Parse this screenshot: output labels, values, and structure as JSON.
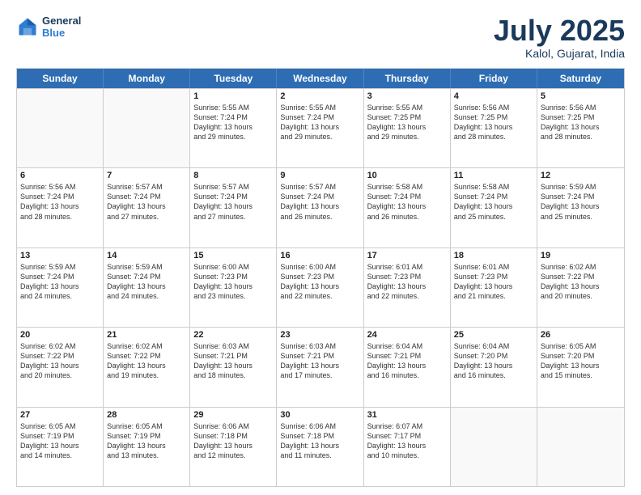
{
  "header": {
    "logo_line1": "General",
    "logo_line2": "Blue",
    "month": "July 2025",
    "location": "Kalol, Gujarat, India"
  },
  "weekdays": [
    "Sunday",
    "Monday",
    "Tuesday",
    "Wednesday",
    "Thursday",
    "Friday",
    "Saturday"
  ],
  "rows": [
    [
      {
        "day": "",
        "lines": []
      },
      {
        "day": "",
        "lines": []
      },
      {
        "day": "1",
        "lines": [
          "Sunrise: 5:55 AM",
          "Sunset: 7:24 PM",
          "Daylight: 13 hours",
          "and 29 minutes."
        ]
      },
      {
        "day": "2",
        "lines": [
          "Sunrise: 5:55 AM",
          "Sunset: 7:24 PM",
          "Daylight: 13 hours",
          "and 29 minutes."
        ]
      },
      {
        "day": "3",
        "lines": [
          "Sunrise: 5:55 AM",
          "Sunset: 7:25 PM",
          "Daylight: 13 hours",
          "and 29 minutes."
        ]
      },
      {
        "day": "4",
        "lines": [
          "Sunrise: 5:56 AM",
          "Sunset: 7:25 PM",
          "Daylight: 13 hours",
          "and 28 minutes."
        ]
      },
      {
        "day": "5",
        "lines": [
          "Sunrise: 5:56 AM",
          "Sunset: 7:25 PM",
          "Daylight: 13 hours",
          "and 28 minutes."
        ]
      }
    ],
    [
      {
        "day": "6",
        "lines": [
          "Sunrise: 5:56 AM",
          "Sunset: 7:24 PM",
          "Daylight: 13 hours",
          "and 28 minutes."
        ]
      },
      {
        "day": "7",
        "lines": [
          "Sunrise: 5:57 AM",
          "Sunset: 7:24 PM",
          "Daylight: 13 hours",
          "and 27 minutes."
        ]
      },
      {
        "day": "8",
        "lines": [
          "Sunrise: 5:57 AM",
          "Sunset: 7:24 PM",
          "Daylight: 13 hours",
          "and 27 minutes."
        ]
      },
      {
        "day": "9",
        "lines": [
          "Sunrise: 5:57 AM",
          "Sunset: 7:24 PM",
          "Daylight: 13 hours",
          "and 26 minutes."
        ]
      },
      {
        "day": "10",
        "lines": [
          "Sunrise: 5:58 AM",
          "Sunset: 7:24 PM",
          "Daylight: 13 hours",
          "and 26 minutes."
        ]
      },
      {
        "day": "11",
        "lines": [
          "Sunrise: 5:58 AM",
          "Sunset: 7:24 PM",
          "Daylight: 13 hours",
          "and 25 minutes."
        ]
      },
      {
        "day": "12",
        "lines": [
          "Sunrise: 5:59 AM",
          "Sunset: 7:24 PM",
          "Daylight: 13 hours",
          "and 25 minutes."
        ]
      }
    ],
    [
      {
        "day": "13",
        "lines": [
          "Sunrise: 5:59 AM",
          "Sunset: 7:24 PM",
          "Daylight: 13 hours",
          "and 24 minutes."
        ]
      },
      {
        "day": "14",
        "lines": [
          "Sunrise: 5:59 AM",
          "Sunset: 7:24 PM",
          "Daylight: 13 hours",
          "and 24 minutes."
        ]
      },
      {
        "day": "15",
        "lines": [
          "Sunrise: 6:00 AM",
          "Sunset: 7:23 PM",
          "Daylight: 13 hours",
          "and 23 minutes."
        ]
      },
      {
        "day": "16",
        "lines": [
          "Sunrise: 6:00 AM",
          "Sunset: 7:23 PM",
          "Daylight: 13 hours",
          "and 22 minutes."
        ]
      },
      {
        "day": "17",
        "lines": [
          "Sunrise: 6:01 AM",
          "Sunset: 7:23 PM",
          "Daylight: 13 hours",
          "and 22 minutes."
        ]
      },
      {
        "day": "18",
        "lines": [
          "Sunrise: 6:01 AM",
          "Sunset: 7:23 PM",
          "Daylight: 13 hours",
          "and 21 minutes."
        ]
      },
      {
        "day": "19",
        "lines": [
          "Sunrise: 6:02 AM",
          "Sunset: 7:22 PM",
          "Daylight: 13 hours",
          "and 20 minutes."
        ]
      }
    ],
    [
      {
        "day": "20",
        "lines": [
          "Sunrise: 6:02 AM",
          "Sunset: 7:22 PM",
          "Daylight: 13 hours",
          "and 20 minutes."
        ]
      },
      {
        "day": "21",
        "lines": [
          "Sunrise: 6:02 AM",
          "Sunset: 7:22 PM",
          "Daylight: 13 hours",
          "and 19 minutes."
        ]
      },
      {
        "day": "22",
        "lines": [
          "Sunrise: 6:03 AM",
          "Sunset: 7:21 PM",
          "Daylight: 13 hours",
          "and 18 minutes."
        ]
      },
      {
        "day": "23",
        "lines": [
          "Sunrise: 6:03 AM",
          "Sunset: 7:21 PM",
          "Daylight: 13 hours",
          "and 17 minutes."
        ]
      },
      {
        "day": "24",
        "lines": [
          "Sunrise: 6:04 AM",
          "Sunset: 7:21 PM",
          "Daylight: 13 hours",
          "and 16 minutes."
        ]
      },
      {
        "day": "25",
        "lines": [
          "Sunrise: 6:04 AM",
          "Sunset: 7:20 PM",
          "Daylight: 13 hours",
          "and 16 minutes."
        ]
      },
      {
        "day": "26",
        "lines": [
          "Sunrise: 6:05 AM",
          "Sunset: 7:20 PM",
          "Daylight: 13 hours",
          "and 15 minutes."
        ]
      }
    ],
    [
      {
        "day": "27",
        "lines": [
          "Sunrise: 6:05 AM",
          "Sunset: 7:19 PM",
          "Daylight: 13 hours",
          "and 14 minutes."
        ]
      },
      {
        "day": "28",
        "lines": [
          "Sunrise: 6:05 AM",
          "Sunset: 7:19 PM",
          "Daylight: 13 hours",
          "and 13 minutes."
        ]
      },
      {
        "day": "29",
        "lines": [
          "Sunrise: 6:06 AM",
          "Sunset: 7:18 PM",
          "Daylight: 13 hours",
          "and 12 minutes."
        ]
      },
      {
        "day": "30",
        "lines": [
          "Sunrise: 6:06 AM",
          "Sunset: 7:18 PM",
          "Daylight: 13 hours",
          "and 11 minutes."
        ]
      },
      {
        "day": "31",
        "lines": [
          "Sunrise: 6:07 AM",
          "Sunset: 7:17 PM",
          "Daylight: 13 hours",
          "and 10 minutes."
        ]
      },
      {
        "day": "",
        "lines": []
      },
      {
        "day": "",
        "lines": []
      }
    ]
  ]
}
